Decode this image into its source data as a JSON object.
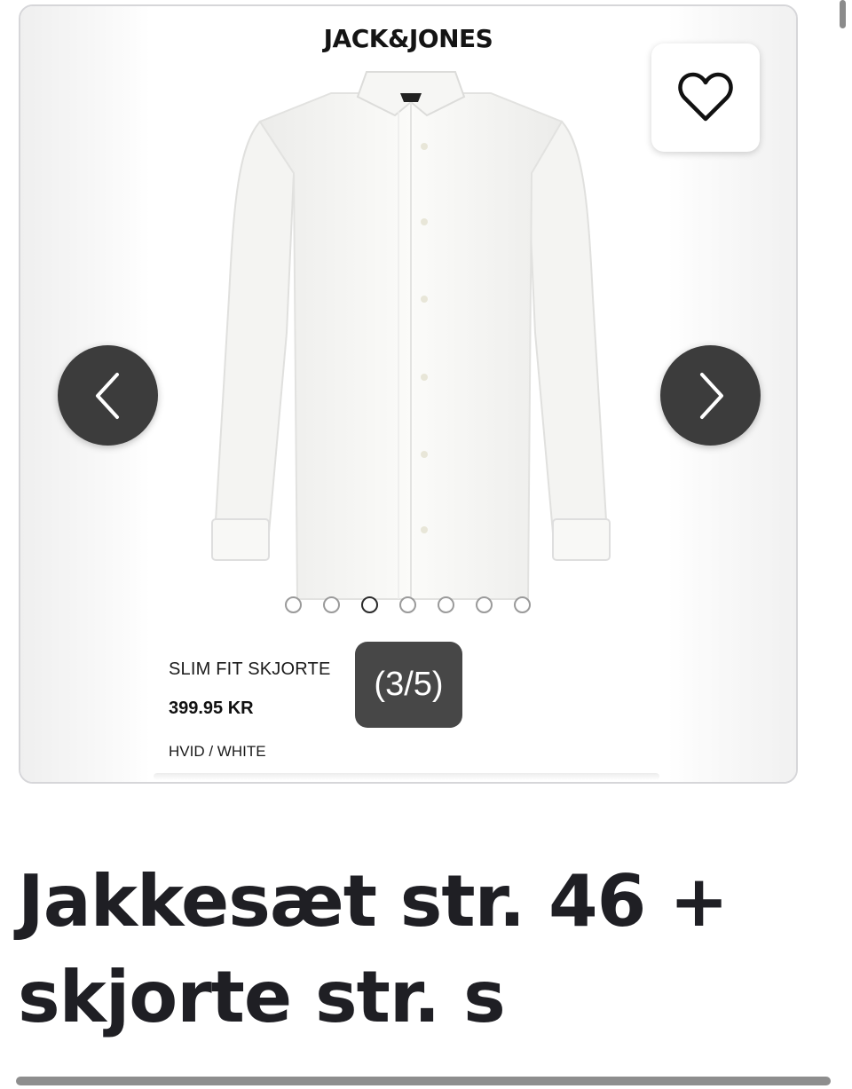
{
  "gallery": {
    "brand": "JACK&JONES",
    "product_name": "SLIM FIT SKJORTE",
    "product_price": "399.95 KR",
    "product_color": "HVID / WHITE",
    "counter": "(3/5)",
    "dots_total": 7,
    "active_dot": 3
  },
  "listing": {
    "title": "Jakkesæt str. 46 + skjorte str. s"
  },
  "icons": {
    "favorite": "heart-icon",
    "previous": "chevron-left-icon",
    "next": "chevron-right-icon"
  },
  "colors": {
    "nav_button": "#3c3c3c",
    "counter_bg": "#474747",
    "title_text": "#1f1f24"
  }
}
